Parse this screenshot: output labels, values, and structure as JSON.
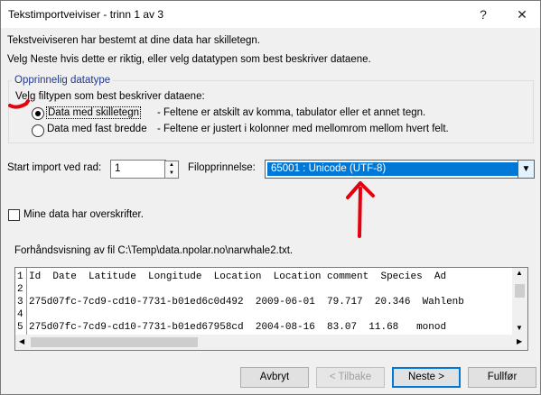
{
  "window": {
    "title": "Tekstimportveiviser - trinn 1 av 3",
    "help_glyph": "?",
    "close_glyph": "✕"
  },
  "intro": {
    "line1": "Tekstveiviseren har bestemt at dine data har skilletegn.",
    "line2": "Velg Neste hvis dette er riktig, eller velg datatypen som best beskriver dataene."
  },
  "datatype": {
    "legend": "Opprinnelig datatype",
    "prompt": "Velg filtypen som best beskriver dataene:",
    "options": [
      {
        "label": "Data med skilletegn",
        "desc": "- Feltene er atskilt av komma, tabulator eller et annet tegn.",
        "selected": true
      },
      {
        "label": "Data med fast bredde",
        "desc": "- Feltene er justert i kolonner med mellomrom mellom hvert felt.",
        "selected": false
      }
    ]
  },
  "start_row": {
    "label": "Start import ved rad:",
    "value": "1"
  },
  "file_origin": {
    "label": "Filopprinnelse:",
    "value": "65001 : Unicode (UTF-8)"
  },
  "headers_checkbox": {
    "label": "Mine data har overskrifter.",
    "checked": false
  },
  "preview": {
    "label": "Forhåndsvisning av fil C:\\Temp\\data.npolar.no\\narwhale2.txt.",
    "rows": [
      {
        "num": "1",
        "text": "Id  Date  Latitude  Longitude  Location  Location comment  Species  Ad"
      },
      {
        "num": "2",
        "text": ""
      },
      {
        "num": "3",
        "text": "275d07fc-7cd9-cd10-7731-b01ed6c0d492  2009-06-01  79.717  20.346  Wahlenb"
      },
      {
        "num": "4",
        "text": ""
      },
      {
        "num": "5",
        "text": "275d07fc-7cd9-cd10-7731-b01ed67958cd  2004-08-16  83.07  11.68   monod"
      }
    ]
  },
  "buttons": {
    "cancel": "Avbryt",
    "back": "< Tilbake",
    "next": "Neste >",
    "finish": "Fullfør"
  },
  "colors": {
    "accent": "#0078d7",
    "annotation": "#e3000f"
  }
}
